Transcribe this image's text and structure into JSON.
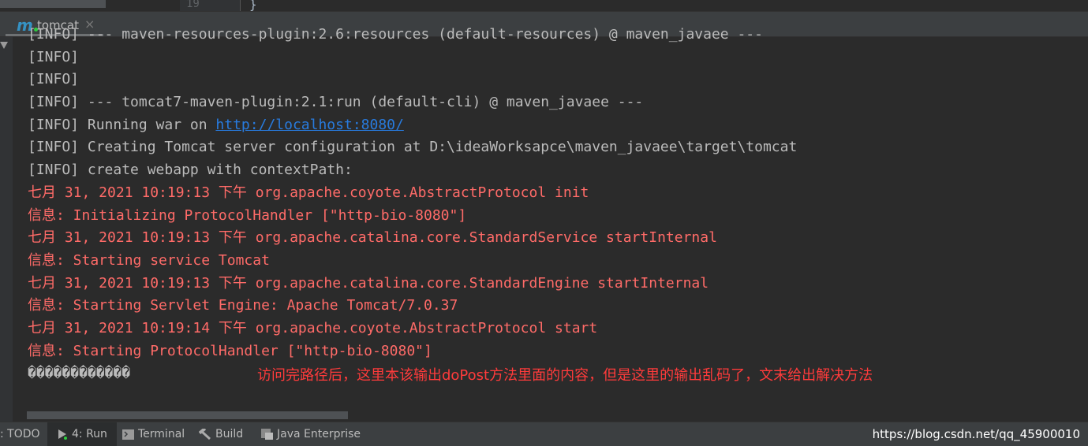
{
  "editor": {
    "line_number": "19",
    "brace": "}"
  },
  "tab": {
    "icon": "maven-icon",
    "label": "tomcat",
    "close": "×"
  },
  "console_lines": [
    {
      "text": "[INFO] --- maven-resources-plugin:2.6:resources (default-resources) @ maven_javaee ---",
      "type": "info"
    },
    {
      "text": "[INFO]",
      "type": "info"
    },
    {
      "text": "[INFO]",
      "type": "info"
    },
    {
      "text": "[INFO] --- tomcat7-maven-plugin:2.1:run (default-cli) @ maven_javaee ---",
      "type": "info"
    },
    {
      "text": "[INFO] Running war on ",
      "type": "info",
      "link": "http://localhost:8080/"
    },
    {
      "text": "[INFO] Creating Tomcat server configuration at D:\\ideaWorksapce\\maven_javaee\\target\\tomcat",
      "type": "info"
    },
    {
      "text": "[INFO] create webapp with contextPath:",
      "type": "info"
    },
    {
      "text": "七月 31, 2021 10:19:13 下午 org.apache.coyote.AbstractProtocol init",
      "type": "err"
    },
    {
      "text": "信息: Initializing ProtocolHandler [\"http-bio-8080\"]",
      "type": "err"
    },
    {
      "text": "七月 31, 2021 10:19:13 下午 org.apache.catalina.core.StandardService startInternal",
      "type": "err"
    },
    {
      "text": "信息: Starting service Tomcat",
      "type": "err"
    },
    {
      "text": "七月 31, 2021 10:19:13 下午 org.apache.catalina.core.StandardEngine startInternal",
      "type": "err"
    },
    {
      "text": "信息: Starting Servlet Engine: Apache Tomcat/7.0.37",
      "type": "err"
    },
    {
      "text": "七月 31, 2021 10:19:14 下午 org.apache.coyote.AbstractProtocol start",
      "type": "err"
    },
    {
      "text": "信息: Starting ProtocolHandler [\"http-bio-8080\"]",
      "type": "err"
    },
    {
      "text": "������������",
      "type": "info"
    }
  ],
  "annotation": "访问完路径后，这里本该输出doPost方法里面的内容，但是这里的输出乱码了，文末给出解决方法",
  "bottom_tabs": [
    {
      "label": ": TODO",
      "icon": ""
    },
    {
      "label": "4: Run",
      "icon": "run-icon",
      "active": true
    },
    {
      "label": "Terminal",
      "icon": "terminal-icon"
    },
    {
      "label": "Build",
      "icon": "hammer-icon"
    },
    {
      "label": "Java Enterprise",
      "icon": "java-enterprise-icon"
    }
  ],
  "watermark": "https://blog.csdn.net/qq_45900010",
  "colors": {
    "info": "#bbbbbb",
    "error": "#ff6b68",
    "link": "#287bde",
    "annotation": "#ff3b3b"
  }
}
